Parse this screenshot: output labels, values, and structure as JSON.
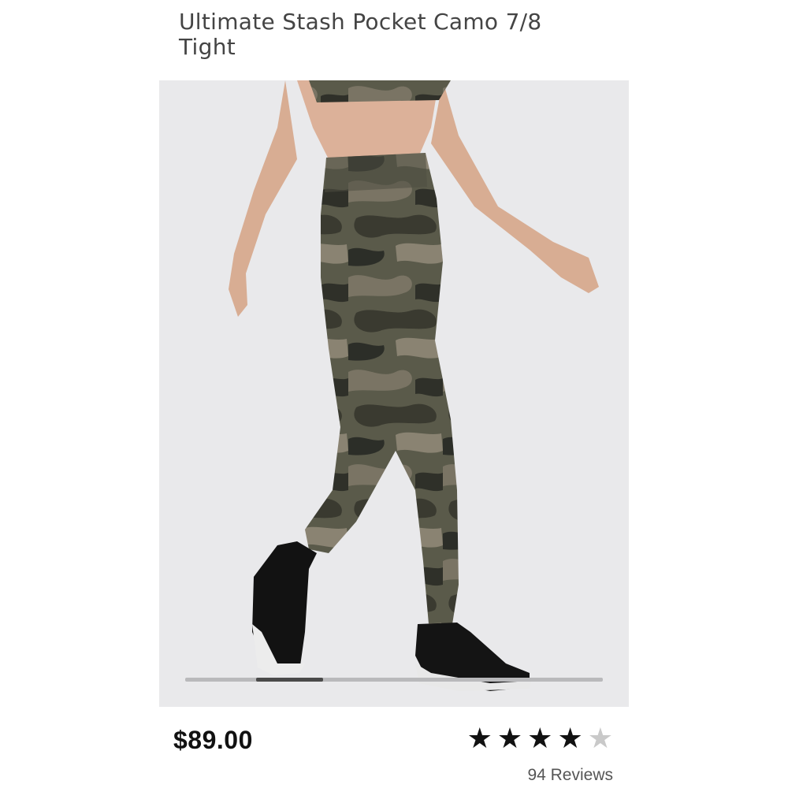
{
  "product": {
    "title": "Ultimate Stash Pocket Camo 7/8 Tight",
    "price": "$89.00",
    "rating_value": 4,
    "rating_max": 5,
    "reviews_label": "94 Reviews"
  },
  "gallery": {
    "image_subject": "camo-leggings-model-photo",
    "scroll_fraction_start": 0.17,
    "scroll_fraction_end": 0.33
  },
  "colors": {
    "background": "#ffffff",
    "gallery_bg": "#e9e9eb",
    "star_full": "#111111",
    "star_empty": "#c9c9c9",
    "scroll_track": "#b9b9bb",
    "scroll_thumb": "#4a4a4a"
  }
}
